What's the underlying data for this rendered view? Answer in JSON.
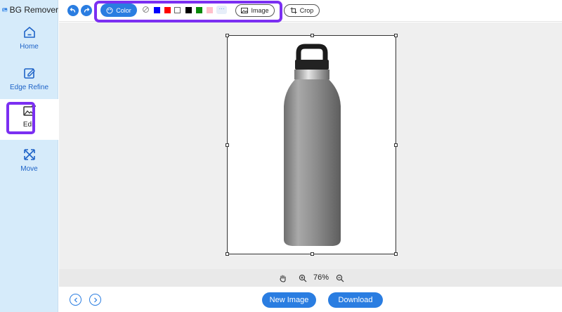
{
  "app": {
    "title": "BG Remover"
  },
  "sidebar": {
    "items": [
      {
        "label": "Home",
        "icon": "home-icon"
      },
      {
        "label": "Edge Refine",
        "icon": "edit-square-icon"
      },
      {
        "label": "Edit",
        "icon": "image-edit-icon",
        "active": true
      },
      {
        "label": "Move",
        "icon": "move-arrows-icon"
      }
    ]
  },
  "toolbar": {
    "undo_icon": "undo-icon",
    "redo_icon": "redo-icon",
    "color_label": "Color",
    "swatches": [
      "#0000ff",
      "#ff0000",
      "#ffffff",
      "#000000",
      "#0a8a0a",
      "#ffc0cb"
    ],
    "more_label": "···",
    "image_label": "Image",
    "crop_label": "Crop"
  },
  "zoom": {
    "level": "76%"
  },
  "bottom": {
    "new_image_label": "New Image",
    "download_label": "Download"
  },
  "colors": {
    "accent": "#2a7de1",
    "highlight": "#7b2ff2",
    "sidebar_bg": "#d6ebfa",
    "canvas_bg": "#efefef"
  }
}
